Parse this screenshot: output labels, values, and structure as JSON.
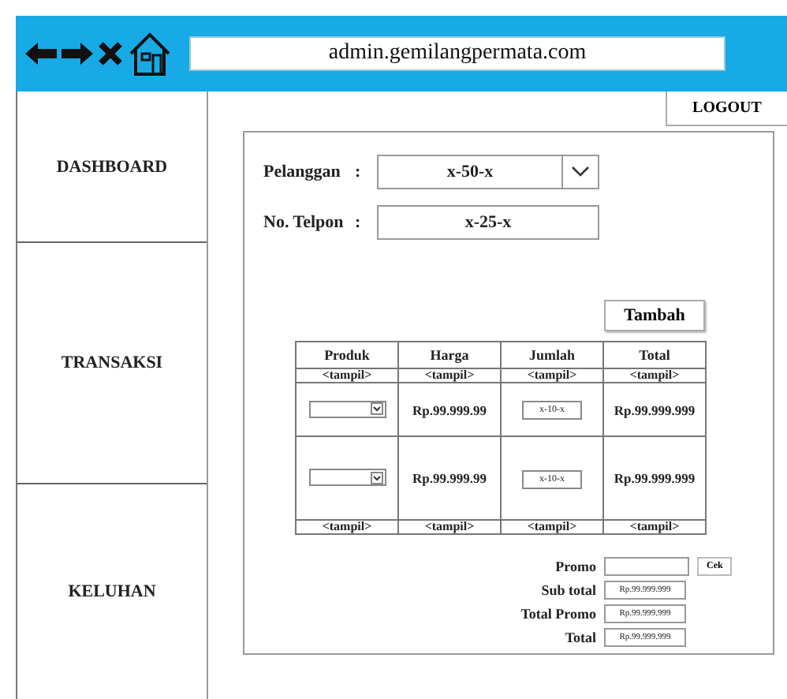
{
  "browser": {
    "address": "admin.gemilangpermata.com"
  },
  "sidebar": {
    "items": [
      {
        "label": "DASHBOARD",
        "selected": false
      },
      {
        "label": "TRANSAKSI",
        "selected": false
      },
      {
        "label": "KELUHAN",
        "selected": false
      }
    ]
  },
  "logout": "LOGOUT",
  "form": {
    "customer": {
      "label": "Pelanggan",
      "colon": ":",
      "value": "x-50-x"
    },
    "phone": {
      "label": "No. Telpon",
      "colon": ":",
      "value": "x-25-x"
    },
    "add_button": "Tambah"
  },
  "table": {
    "columns": [
      "Produk",
      "Harga",
      "Jumlah",
      "Total"
    ],
    "rows": [
      {
        "kind": "display",
        "cells": [
          "<tampil>",
          "<tampil>",
          "<tampil>",
          "<tampil>"
        ]
      },
      {
        "kind": "input",
        "price": "Rp.99.999.99",
        "quantity": "x-10-x",
        "total": "Rp.99.999.999"
      },
      {
        "kind": "input",
        "price": "Rp.99.999.99",
        "quantity": "x-10-x",
        "total": "Rp.99.999.999"
      },
      {
        "kind": "display",
        "cells": [
          "<tampil>",
          "<tampil>",
          "<tampil>",
          "<tampil>"
        ]
      }
    ]
  },
  "summary": {
    "promo_label": "Promo",
    "check_button": "Cek",
    "lines": [
      {
        "label": "Sub total",
        "value": "Rp.99.999.999"
      },
      {
        "label": "Total Promo",
        "value": "Rp.99.999.999"
      },
      {
        "label": "Total",
        "value": "Rp.99.999.999"
      }
    ]
  }
}
